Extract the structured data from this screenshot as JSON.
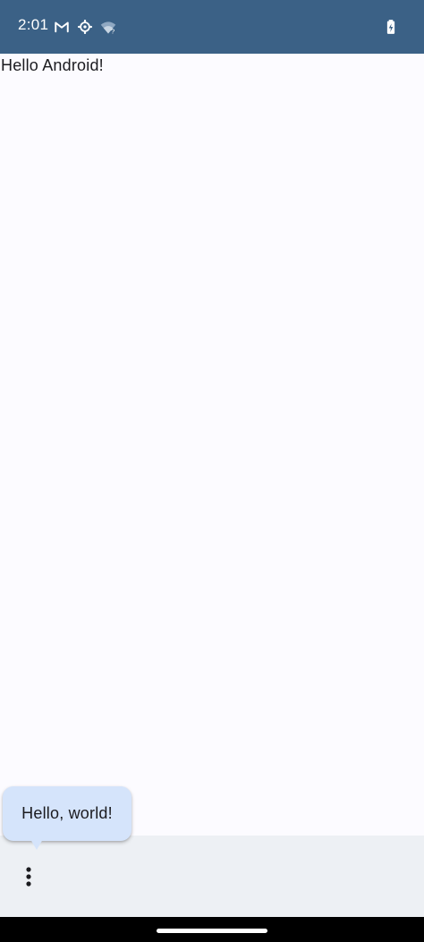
{
  "status_bar": {
    "time": "2:01",
    "icons": [
      "gmail-icon",
      "settings-gear-icon",
      "wifi-unknown-icon",
      "battery-charging-icon"
    ],
    "background_color": "#3b6186"
  },
  "main": {
    "greeting": "Hello Android!"
  },
  "tooltip": {
    "text": "Hello, world!",
    "background_color": "#d5e4fb"
  },
  "bottom_bar": {
    "more_icon": "more-vert-icon",
    "background_color": "#edf0f4"
  }
}
